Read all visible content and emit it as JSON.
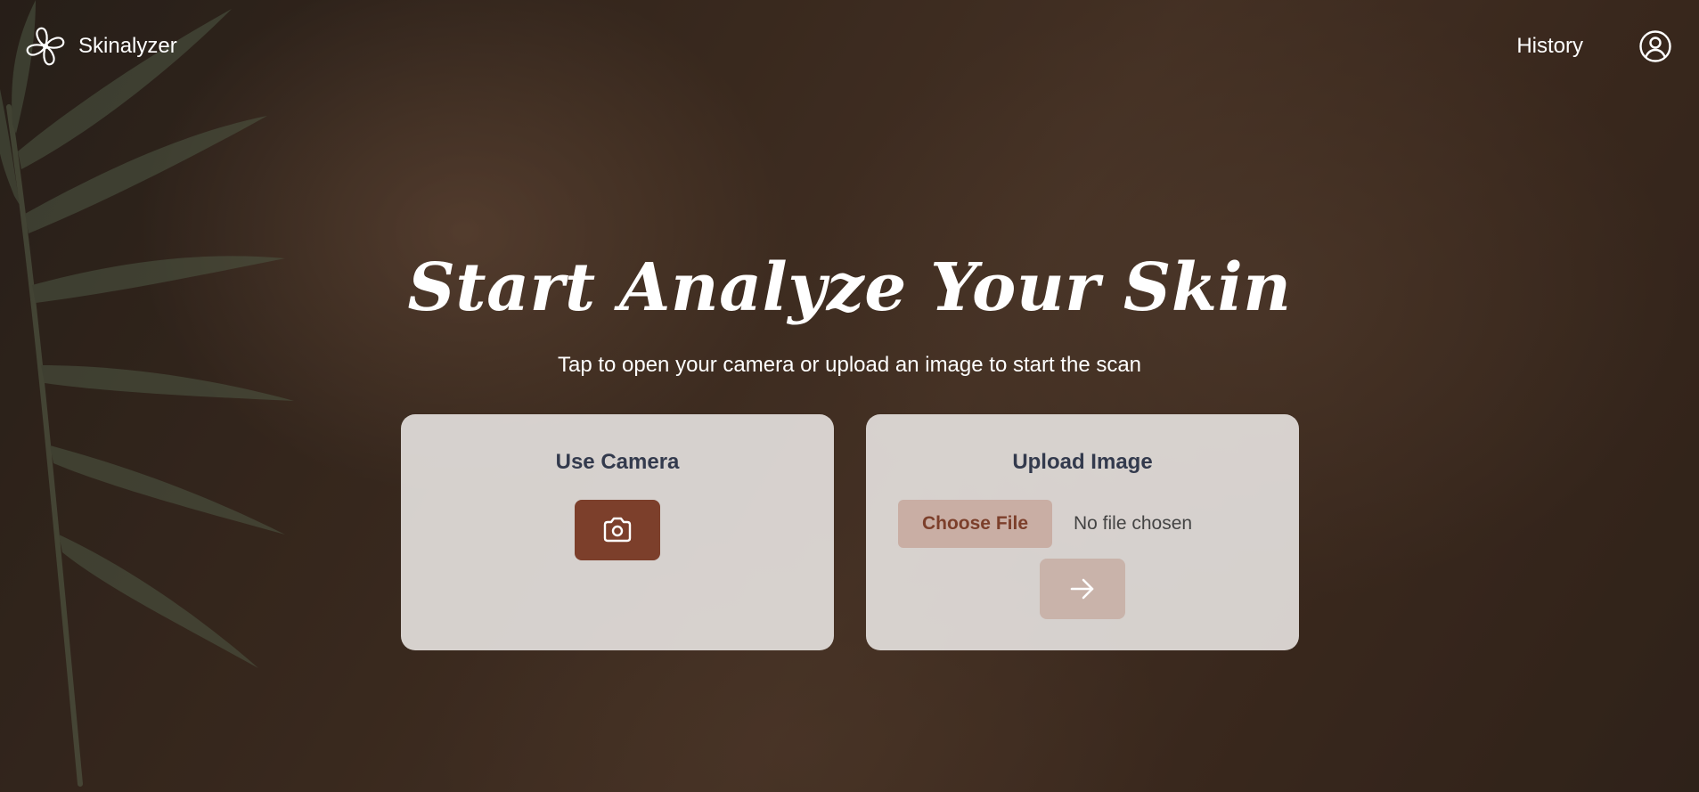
{
  "brand": {
    "name": "Skinalyzer",
    "logo_icon": "flower-logo-icon"
  },
  "nav": {
    "history_label": "History",
    "profile_icon": "user-circle-icon"
  },
  "hero": {
    "title": "Start Analyze Your Skin",
    "subtitle": "Tap to open your camera or upload an image to start the scan"
  },
  "camera_card": {
    "title": "Use Camera",
    "button_icon": "camera-icon"
  },
  "upload_card": {
    "title": "Upload Image",
    "choose_file_label": "Choose File",
    "file_status": "No file chosen",
    "submit_icon": "arrow-right-icon"
  },
  "colors": {
    "accent": "#7c3f2b",
    "card_title": "#333a4d",
    "choose_file_bg": "#c9aea4",
    "submit_bg_disabled": "#c9b3aa"
  }
}
